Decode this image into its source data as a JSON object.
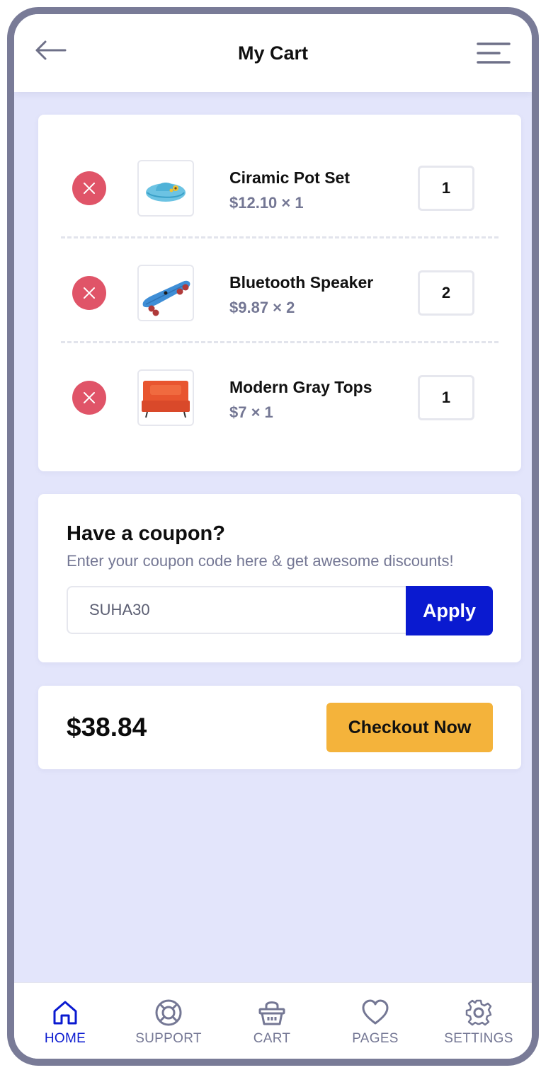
{
  "header": {
    "title": "My Cart",
    "back_icon": "arrow-left-icon",
    "menu_icon": "menu-icon"
  },
  "cart": {
    "items": [
      {
        "name": "Ciramic Pot Set",
        "price": "$12.10 × 1",
        "quantity": "1",
        "image": "sun-hat-image"
      },
      {
        "name": "Bluetooth Speaker",
        "price": "$9.87 × 2",
        "quantity": "2",
        "image": "skateboard-image"
      },
      {
        "name": "Modern Gray Tops",
        "price": "$7 × 1",
        "quantity": "1",
        "image": "orange-sofa-image"
      }
    ]
  },
  "coupon": {
    "title": "Have a coupon?",
    "subtitle": "Enter your coupon code here & get awesome discounts!",
    "code_value": "SUHA30",
    "apply_label": "Apply"
  },
  "total": {
    "amount": "$38.84",
    "checkout_label": "Checkout Now"
  },
  "nav": {
    "items": [
      {
        "label": "HOME",
        "icon": "home-icon",
        "active": true
      },
      {
        "label": "SUPPORT",
        "icon": "lifebuoy-icon",
        "active": false
      },
      {
        "label": "CART",
        "icon": "basket-icon",
        "active": false
      },
      {
        "label": "PAGES",
        "icon": "heart-icon",
        "active": false
      },
      {
        "label": "SETTINGS",
        "icon": "gear-icon",
        "active": false
      }
    ]
  },
  "colors": {
    "background": "#e3e5fb",
    "primary": "#0a1ad0",
    "accent": "#f4b33b",
    "danger": "#e05468",
    "muted_text": "#747794"
  }
}
